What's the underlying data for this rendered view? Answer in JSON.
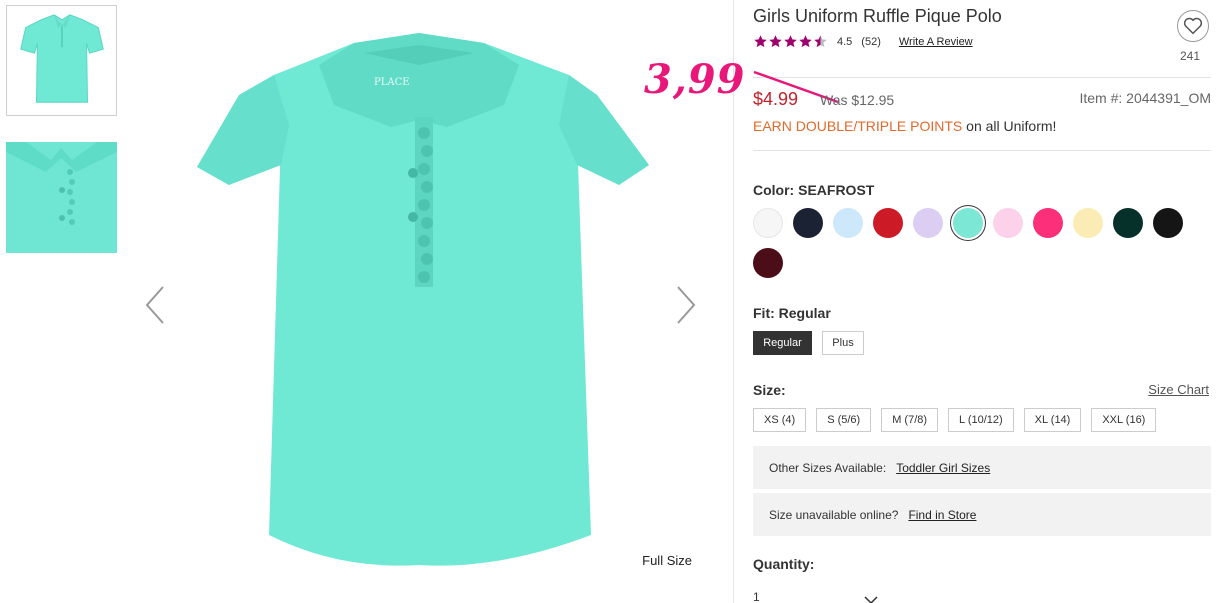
{
  "product": {
    "title": "Girls Uniform Ruffle Pique Polo",
    "rating_value": "4.5",
    "rating_stars": 4.5,
    "review_count": "(52)",
    "write_review": "Write A Review",
    "favorite_count": "241",
    "price": "$4.99",
    "was_price": "Was $12.95",
    "item_number": "Item #: 2044391_OM",
    "promo_highlight": "EARN DOUBLE/TRIPLE POINTS",
    "promo_rest": " on all Uniform!",
    "handwritten_price": "3,99"
  },
  "image": {
    "full_size_label": "Full Size",
    "shirt_color": "#6fe8d4",
    "shirt_logo": "PLACE"
  },
  "color": {
    "label": "Color: SEAFROST",
    "swatches": [
      {
        "name": "white",
        "hex": "#f6f6f6"
      },
      {
        "name": "navy",
        "hex": "#1b2234"
      },
      {
        "name": "light-blue",
        "hex": "#cde8fb"
      },
      {
        "name": "red",
        "hex": "#cc1a26"
      },
      {
        "name": "lavender",
        "hex": "#dccdf2"
      },
      {
        "name": "seafrost",
        "hex": "#7ce7d5",
        "selected": true
      },
      {
        "name": "light-pink",
        "hex": "#fbd2e9"
      },
      {
        "name": "hot-pink",
        "hex": "#fb2f7a"
      },
      {
        "name": "yellow",
        "hex": "#faecb4"
      },
      {
        "name": "dark-green",
        "hex": "#06302a"
      },
      {
        "name": "black",
        "hex": "#151515"
      },
      {
        "name": "burgundy",
        "hex": "#4b0d18"
      }
    ]
  },
  "fit": {
    "label": "Fit: Regular",
    "options": [
      "Regular",
      "Plus"
    ]
  },
  "size": {
    "label": "Size:",
    "chart_link": "Size Chart",
    "options": [
      "XS (4)",
      "S (5/6)",
      "M (7/8)",
      "L (10/12)",
      "XL (14)",
      "XXL (16)"
    ]
  },
  "info": {
    "other_sizes_label": "Other Sizes Available:",
    "other_sizes_link": "Toddler Girl Sizes",
    "unavailable_label": "Size unavailable online?",
    "unavailable_link": "Find in Store"
  },
  "quantity": {
    "label": "Quantity:",
    "value": "1"
  }
}
